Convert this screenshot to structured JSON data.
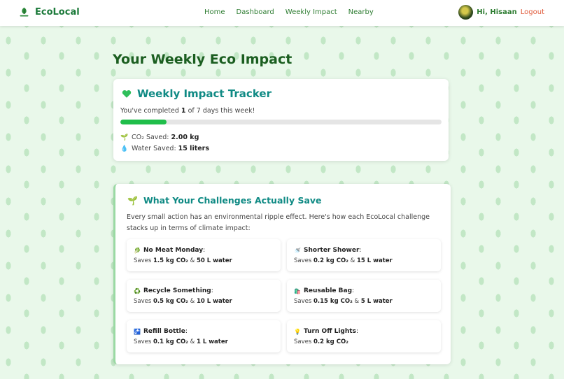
{
  "brand": {
    "name": "EcoLocal"
  },
  "nav": {
    "links": [
      "Home",
      "Dashboard",
      "Weekly Impact",
      "Nearby"
    ]
  },
  "user": {
    "greeting": "Hi, Hisaan",
    "logout": "Logout"
  },
  "page": {
    "title": "Your Weekly Eco Impact"
  },
  "tracker": {
    "title": "Weekly Impact Tracker",
    "progress_prefix": "You've completed",
    "completed": "1",
    "progress_mid": "of 7 days this week!",
    "progress_fraction": 0.143,
    "co2_label": "CO₂ Saved:",
    "co2_value": "2.00 kg",
    "water_label": "Water Saved:",
    "water_value": "15 liters",
    "colors": {
      "title": "#0f8a84",
      "progress": "#1fbe4a"
    }
  },
  "savings": {
    "title": "What Your Challenges Actually Save",
    "intro": "Every small action has an environmental ripple effect. Here's how each EcoLocal challenge stacks up in terms of climate impact:",
    "saves_word": "Saves",
    "challenges": [
      {
        "icon": "leafy-green-icon",
        "glyph": "🥬",
        "name": "No Meat Monday",
        "co2": "1.5 kg CO₂",
        "water": "50 L water"
      },
      {
        "icon": "shower-icon",
        "glyph": "🚿",
        "name": "Shorter Shower",
        "co2": "0.2 kg CO₂",
        "water": "15 L water"
      },
      {
        "icon": "recycle-icon",
        "glyph": "♻️",
        "name": "Recycle Something",
        "co2": "0.5 kg CO₂",
        "water": "10 L water"
      },
      {
        "icon": "shopping-bag-icon",
        "glyph": "🛍️",
        "name": "Reusable Bag",
        "co2": "0.15 kg CO₂",
        "water": "5 L water"
      },
      {
        "icon": "water-bottle-icon",
        "glyph": "🚰",
        "name": "Refill Bottle",
        "co2": "0.1 kg CO₂",
        "water": "1 L water"
      },
      {
        "icon": "lightbulb-icon",
        "glyph": "💡",
        "name": "Turn Off Lights",
        "co2": "0.2 kg CO₂",
        "water": ""
      }
    ]
  }
}
